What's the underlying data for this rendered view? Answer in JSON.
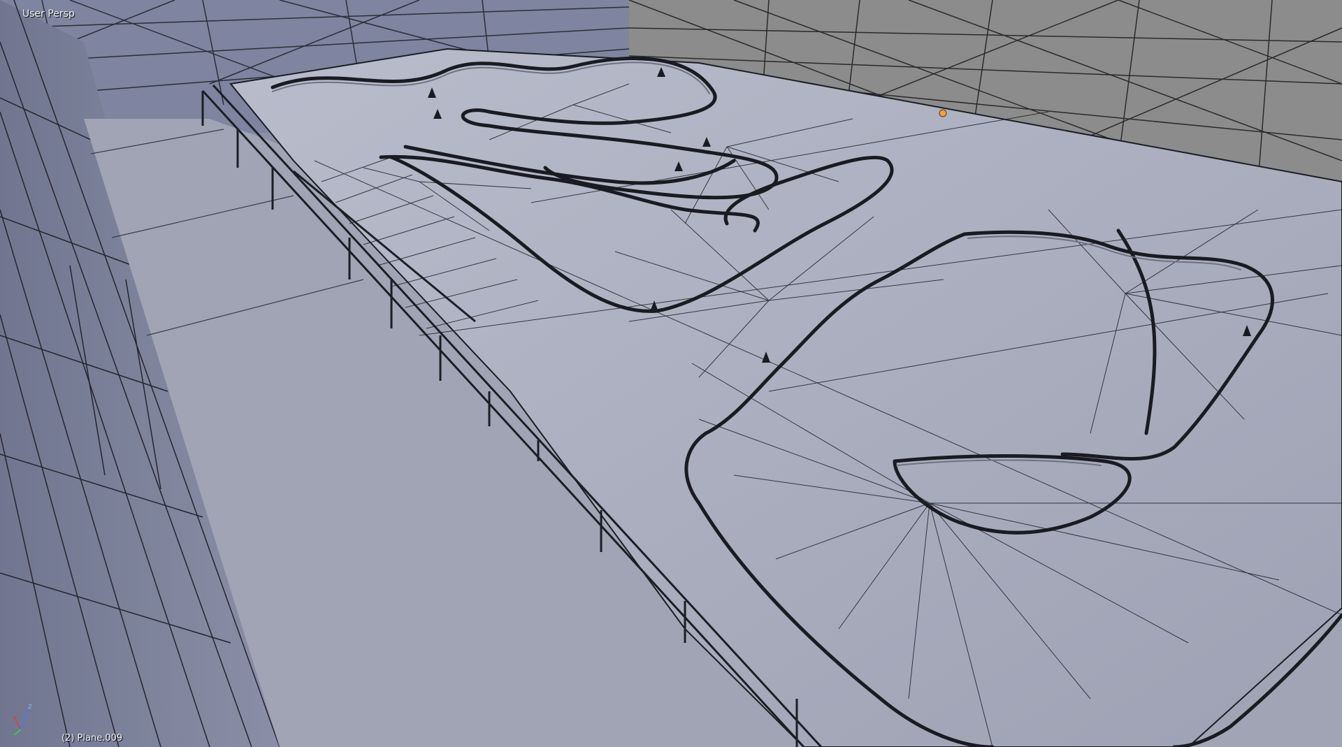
{
  "viewport": {
    "view_label": "User Persp",
    "object_label": "(2) Plane.009",
    "background_color": "#8b90a6",
    "floor_color": "#a3a6b6",
    "wire_color": "#1b1d24"
  },
  "axis_gizmo": {
    "x_label": "x",
    "z_label": "z",
    "x_color": "#e23b3b",
    "y_color": "#3bd13b",
    "z_color": "#4a7ae8"
  }
}
